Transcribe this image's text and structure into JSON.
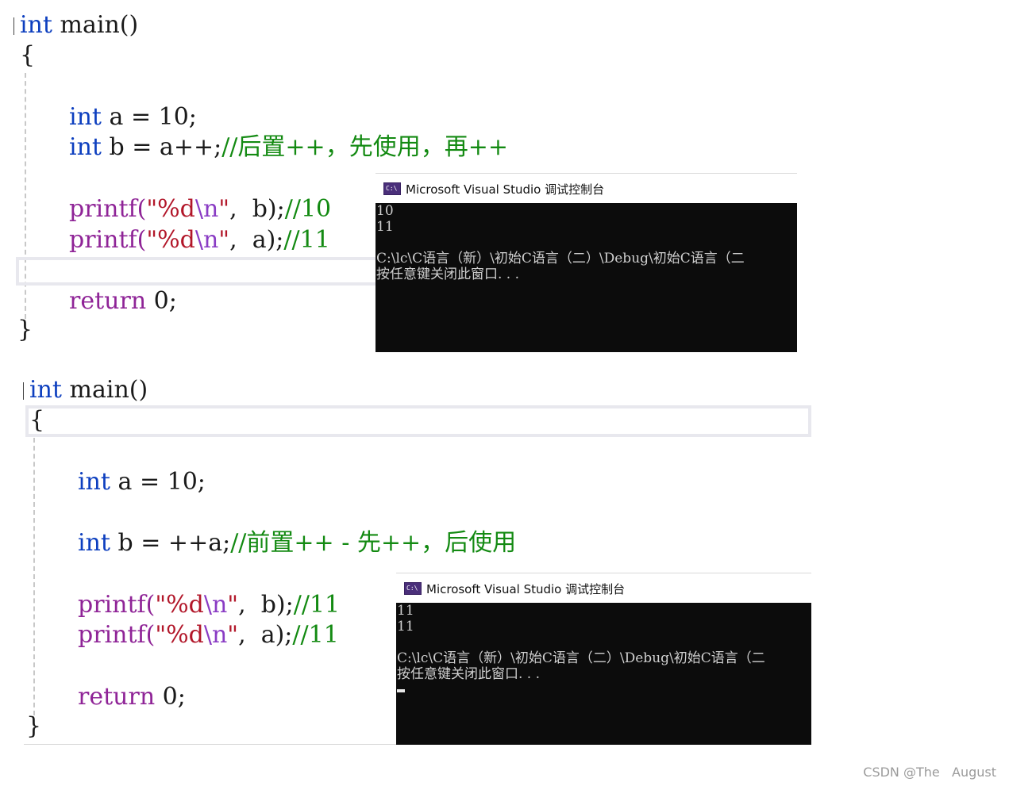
{
  "snippet1": {
    "line_main": {
      "kw": "int",
      "rest": " main()"
    },
    "open_brace": "{",
    "line_a": {
      "kw": "int",
      "rest": " a = 10;"
    },
    "line_b": {
      "kw": "int",
      "rest": " b = a++;",
      "comment": "//后置++，先使用，再++"
    },
    "printf_b": {
      "fn": "printf(",
      "q1": "\"",
      "fmt": "%d",
      "esc": "\\n",
      "q2": "\"",
      "rest": ",  b);",
      "comment": "//10"
    },
    "printf_a": {
      "fn": "printf(",
      "q1": "\"",
      "fmt": "%d",
      "esc": "\\n",
      "q2": "\"",
      "rest": ",  a);",
      "comment": "//11"
    },
    "line_return": {
      "kw": "return",
      "rest": " 0;"
    },
    "close_brace": "}",
    "console": {
      "title": "Microsoft Visual Studio 调试控制台",
      "lines": [
        "10",
        "11",
        "",
        "C:\\lc\\C语言（新）\\初始C语言（二）\\Debug\\初始C语言（二",
        "按任意键关闭此窗口. . ."
      ]
    }
  },
  "snippet2": {
    "line_main": {
      "kw": "int",
      "rest": " main()"
    },
    "open_brace": "{",
    "line_a": {
      "kw": "int",
      "rest": " a = 10;"
    },
    "line_b": {
      "kw": "int",
      "rest": " b = ++a;",
      "comment": "//前置++ - 先++，后使用"
    },
    "printf_b": {
      "fn": "printf(",
      "q1": "\"",
      "fmt": "%d",
      "esc": "\\n",
      "q2": "\"",
      "rest": ",  b);",
      "comment": "//11"
    },
    "printf_a": {
      "fn": "printf(",
      "q1": "\"",
      "fmt": "%d",
      "esc": "\\n",
      "q2": "\"",
      "rest": ",  a);",
      "comment": "//11"
    },
    "line_return": {
      "kw": "return",
      "rest": " 0;"
    },
    "close_brace": "}",
    "console": {
      "title": "Microsoft Visual Studio 调试控制台",
      "lines": [
        "11",
        "11",
        "",
        "C:\\lc\\C语言（新）\\初始C语言（二）\\Debug\\初始C语言（二",
        "按任意键关闭此窗口. . ."
      ]
    }
  },
  "watermark": "CSDN @The   August",
  "colors": {
    "keyword": "#0d3fbf",
    "function": "#8f2497",
    "string": "#b2172a",
    "escape": "#8a3cc4",
    "comment": "#138a12",
    "console_bg": "#0c0c0c",
    "console_text": "#d0d0d0"
  },
  "icons": {
    "console_icon": "console-app-icon"
  }
}
